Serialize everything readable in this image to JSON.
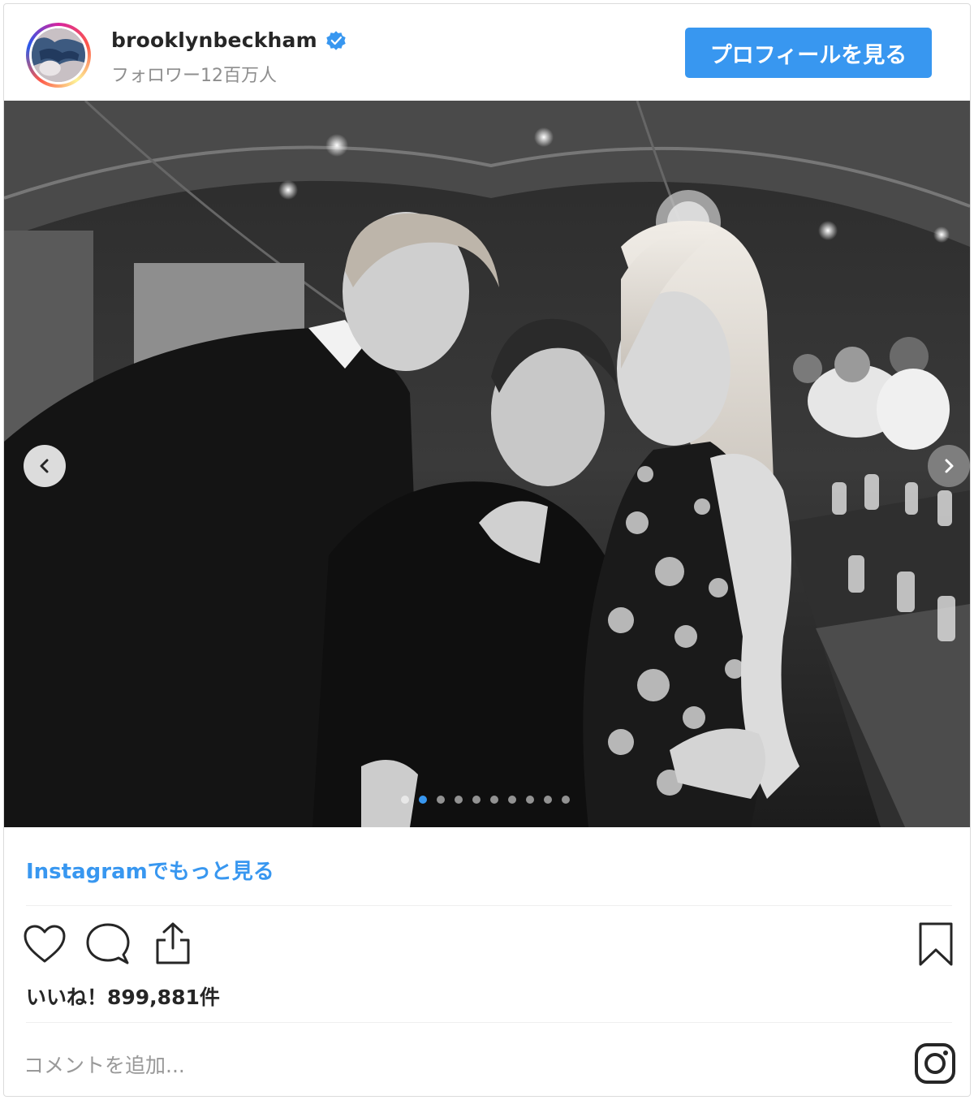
{
  "header": {
    "username": "brooklynbeckham",
    "followers": "フォロワー12百万人",
    "profile_button": "プロフィールを見る",
    "avatar_icon": "avatar-image",
    "verified_icon": "verified-badge-icon"
  },
  "carousel": {
    "prev_icon": "chevron-left-icon",
    "next_icon": "chevron-right-icon",
    "dot_count": 10,
    "active_dot": 1
  },
  "footer": {
    "more_link": "Instagramでもっと見る",
    "likes": "いいね！899,881件",
    "comment_placeholder": "コメントを追加...",
    "actions": [
      "heart-icon",
      "comment-icon",
      "share-icon",
      "bookmark-icon",
      "instagram-logo-icon"
    ]
  },
  "colors": {
    "accent": "#3897f0",
    "text": "#262626",
    "muted": "#8e8e8e",
    "border": "#dbdbdb"
  }
}
